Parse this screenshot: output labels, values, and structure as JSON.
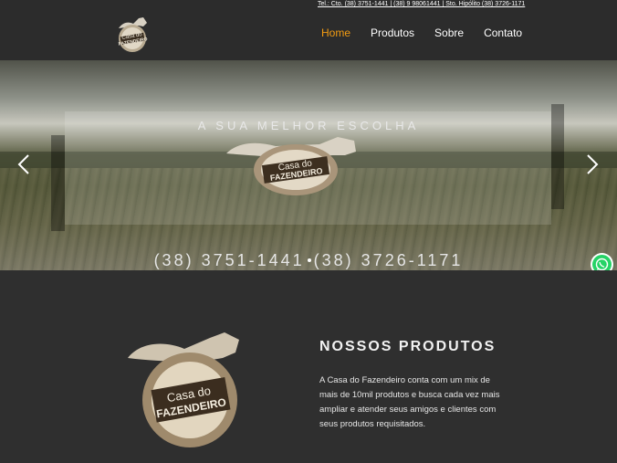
{
  "header": {
    "contact_line": "Tel.: Cto. (38) 3751-1441 | (38) 9 98061441 | Sto. Hipólito (38) 3726-1171",
    "logo_name": "Casa do Fazendeiro logo"
  },
  "nav": {
    "items": [
      {
        "label": "Home",
        "active": true
      },
      {
        "label": "Produtos",
        "active": false
      },
      {
        "label": "Sobre",
        "active": false
      },
      {
        "label": "Contato",
        "active": false
      }
    ],
    "active_color": "#f39c12"
  },
  "hero": {
    "tagline": "A SUA MELHOR ESCOLHA",
    "phone_1": "(38) 3751-1441",
    "phone_2": "(38) 3726-1171",
    "logo_line_1": "Casa do",
    "logo_line_2": "FAZENDEIRO",
    "prev_icon": "chevron-left-icon",
    "next_icon": "chevron-right-icon"
  },
  "whatsapp": {
    "icon": "whatsapp-icon",
    "color": "#25d366"
  },
  "products": {
    "title": "NOSSOS PRODUTOS",
    "description": "A Casa do Fazendeiro conta com um mix de mais de 10mil produtos e busca cada vez mais ampliar e atender seus amigos e clientes com seus produtos requisitados.",
    "logo_line_1": "Casa do",
    "logo_line_2": "FAZENDEIRO"
  }
}
